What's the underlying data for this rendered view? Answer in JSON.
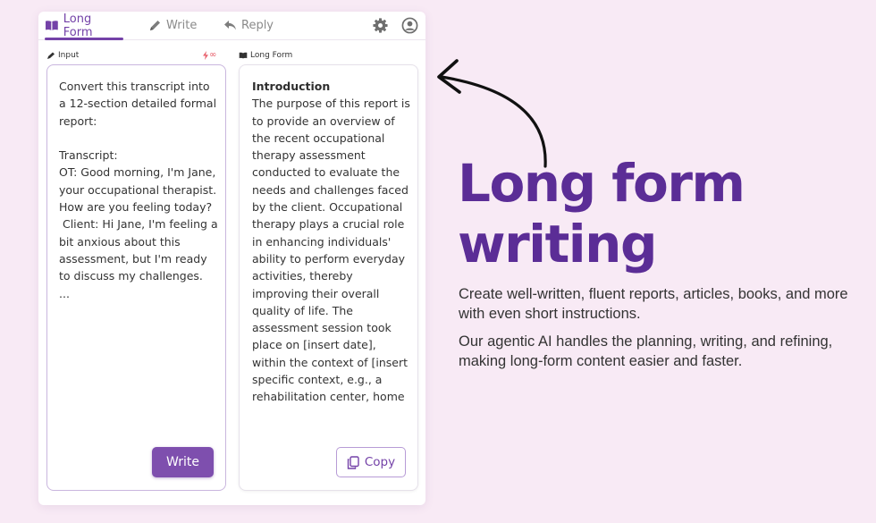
{
  "tabs": [
    {
      "label": "Long Form",
      "icon": "book-icon",
      "active": true
    },
    {
      "label": "Write",
      "icon": "pencil-icon",
      "active": false
    },
    {
      "label": "Reply",
      "icon": "reply-icon",
      "active": false
    }
  ],
  "header_icons": [
    "gear-icon",
    "account-icon"
  ],
  "input_section": {
    "label": "Input",
    "credits": "∞",
    "text": "Convert this transcript into a 12-section detailed formal report:\n\nTranscript:\nOT: Good morning, I'm Jane, your occupational therapist. How are you feeling today?\n Client: Hi Jane, I'm feeling a bit anxious about this assessment, but I'm ready to discuss my challenges.\n...",
    "write_button": "Write"
  },
  "output_section": {
    "label": "Long Form",
    "heading": "Introduction",
    "text": "The purpose of this report is to provide an overview of the recent occupational therapy assessment conducted to evaluate the needs and challenges faced by the client. Occupational therapy plays a crucial role in enhancing individuals' ability to perform everyday activities, thereby improving their overall quality of life. The assessment session took place on [insert date], within the context of [insert specific context, e.g., a rehabilitation center, home",
    "copy_button": "Copy"
  },
  "marketing": {
    "headline": "Long form writing",
    "description_1": "Create well-written, fluent reports, articles, books, and more with even short instructions.",
    "description_2": "Our agentic AI handles the planning, writing, and refining, making long-form content easier and faster."
  },
  "colors": {
    "accent": "#7442a8",
    "headline": "#5b2d96",
    "background": "#f8eaf5",
    "credits": "#e8606c"
  }
}
